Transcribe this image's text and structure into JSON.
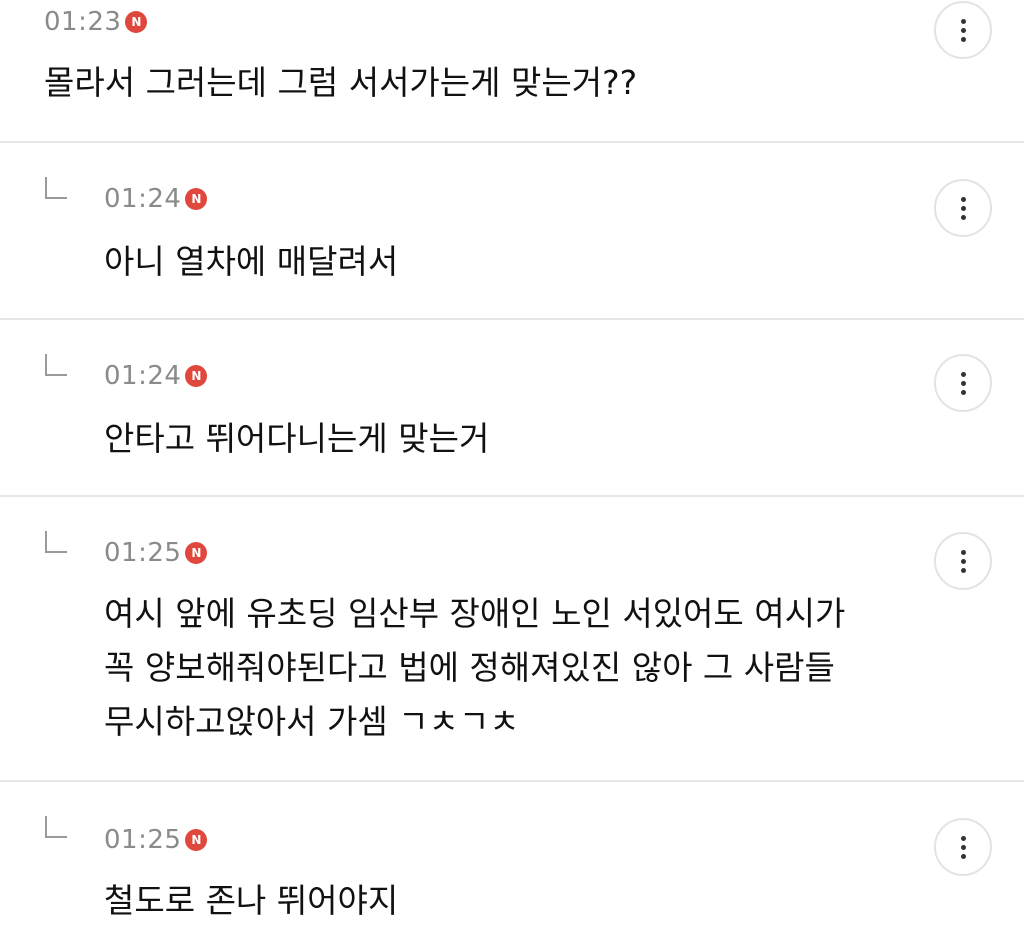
{
  "comments": [
    {
      "time": "01:23",
      "badge": "N",
      "text": "몰라서 그러는데 그럼 서서가는게 맞는거??",
      "is_reply": false
    },
    {
      "time": "01:24",
      "badge": "N",
      "text": "아니 열차에 매달려서",
      "is_reply": true
    },
    {
      "time": "01:24",
      "badge": "N",
      "text": "안타고 뛰어다니는게 맞는거",
      "is_reply": true
    },
    {
      "time": "01:25",
      "badge": "N",
      "text": "여시 앞에 유초딩 임산부 장애인 노인 서있어도 여시가\n꼭 양보해줘야된다고 법에 정해져있진 않아 그 사람들\n무시하고앉아서 가셈 ㄱㅊㄱㅊ",
      "is_reply": true
    },
    {
      "time": "01:25",
      "badge": "N",
      "text": "철도로 존나 뛰어야지",
      "is_reply": true
    }
  ],
  "icons": {
    "reply": "reply-arrow-icon",
    "new": "new-badge-icon",
    "more": "more-vertical-icon"
  },
  "colors": {
    "badge": "#e0483e",
    "timestamp": "#8a8a8a",
    "divider": "#e6e6e6"
  }
}
